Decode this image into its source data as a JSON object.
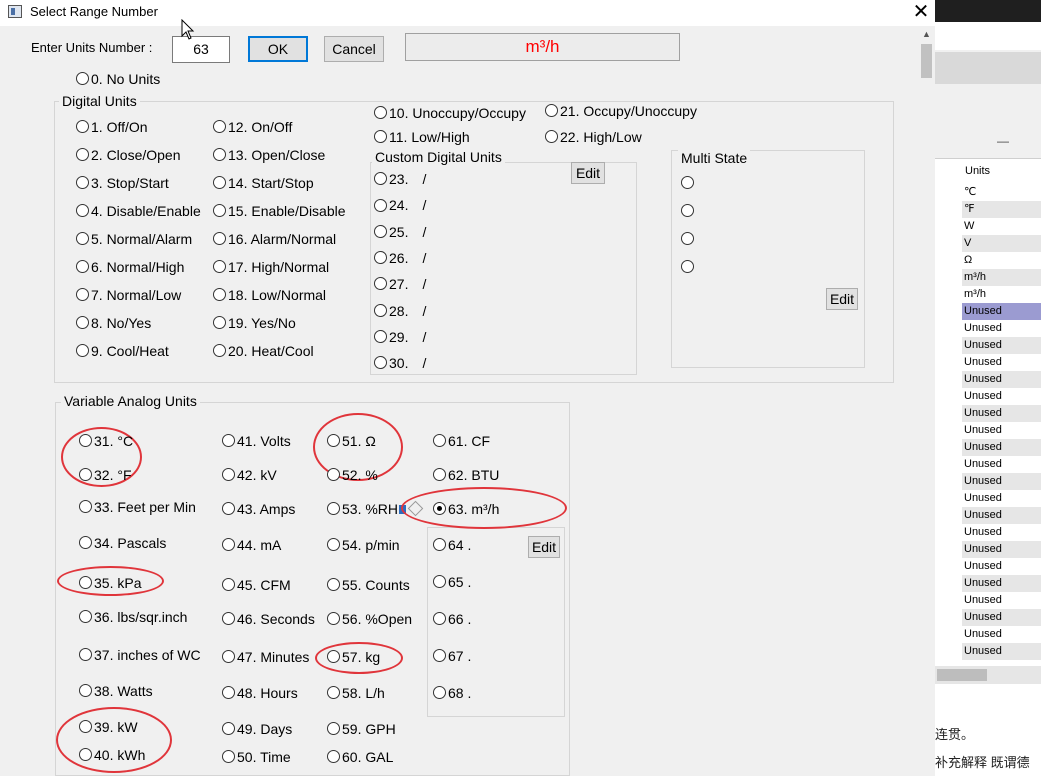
{
  "window": {
    "title": "Select Range Number"
  },
  "header": {
    "enter_label": "Enter Units Number :",
    "input_value": "63",
    "ok_label": "OK",
    "cancel_label": "Cancel",
    "display_value": "m³/h",
    "display_color": "#ff0000"
  },
  "no_units": "0. No Units",
  "digital": {
    "label": "Digital Units",
    "col1": [
      "1. Off/On",
      "2. Close/Open",
      "3. Stop/Start",
      "4. Disable/Enable",
      "5. Normal/Alarm",
      "6. Normal/High",
      "7. Normal/Low",
      "8. No/Yes",
      "9. Cool/Heat"
    ],
    "col2": [
      "12. On/Off",
      "13. Open/Close",
      "14. Start/Stop",
      "15. Enable/Disable",
      "16. Alarm/Normal",
      "17. High/Normal",
      "18. Low/Normal",
      "19. Yes/No",
      "20. Heat/Cool"
    ],
    "col3": [
      "10. Unoccupy/Occupy",
      "11. Low/High"
    ],
    "col4": [
      "21. Occupy/Unoccupy",
      "22. High/Low"
    ]
  },
  "custom_digital": {
    "label": "Custom Digital Units",
    "edit_label": "Edit",
    "items": [
      {
        "num": "23.",
        "sep": "/"
      },
      {
        "num": "24.",
        "sep": "/"
      },
      {
        "num": "25.",
        "sep": "/"
      },
      {
        "num": "26.",
        "sep": "/"
      },
      {
        "num": "27.",
        "sep": "/"
      },
      {
        "num": "28.",
        "sep": "/"
      },
      {
        "num": "29.",
        "sep": "/"
      },
      {
        "num": "30.",
        "sep": "/"
      }
    ]
  },
  "multi_state": {
    "label": "Multi State",
    "edit_label": "Edit",
    "count": 4
  },
  "analog": {
    "label": "Variable Analog Units",
    "col1": [
      "31. °C",
      "32. °F",
      "33. Feet per Min",
      "34. Pascals",
      "35. kPa",
      "36. lbs/sqr.inch",
      "37. inches of WC",
      "38. Watts",
      "39. kW",
      "40. kWh"
    ],
    "col2": [
      "41. Volts",
      "42. kV",
      "43. Amps",
      "44. mA",
      "45. CFM",
      "46. Seconds",
      "47. Minutes",
      "48. Hours",
      "49. Days",
      "50. Time"
    ],
    "col3": [
      "51. Ω",
      "52. %",
      "53. %RH",
      "54. p/min",
      "55. Counts",
      "56. %Open",
      "57. kg",
      "58. L/h",
      "59. GPH",
      "60. GAL"
    ],
    "col4": [
      "61. CF",
      "62. BTU",
      "63. m³/h"
    ],
    "custom": [
      "64 .",
      "65 .",
      "66 .",
      "67 .",
      "68 ."
    ],
    "custom_edit_label": "Edit",
    "selected": "63. m³/h"
  },
  "annotation_color": "#e0353b",
  "background_window": {
    "column_header": "Units",
    "rows": [
      "℃",
      "℉",
      "W",
      "V",
      "Ω",
      "m³/h",
      "m³/h",
      "Unused",
      "Unused",
      "Unused",
      "Unused",
      "Unused",
      "Unused",
      "Unused",
      "Unused",
      "Unused",
      "Unused",
      "Unused",
      "Unused",
      "Unused",
      "Unused",
      "Unused",
      "Unused",
      "Unused",
      "Unused",
      "Unused",
      "Unused",
      "Unused"
    ],
    "text1": "连贯。",
    "text2": "补充解释   既谓德"
  }
}
